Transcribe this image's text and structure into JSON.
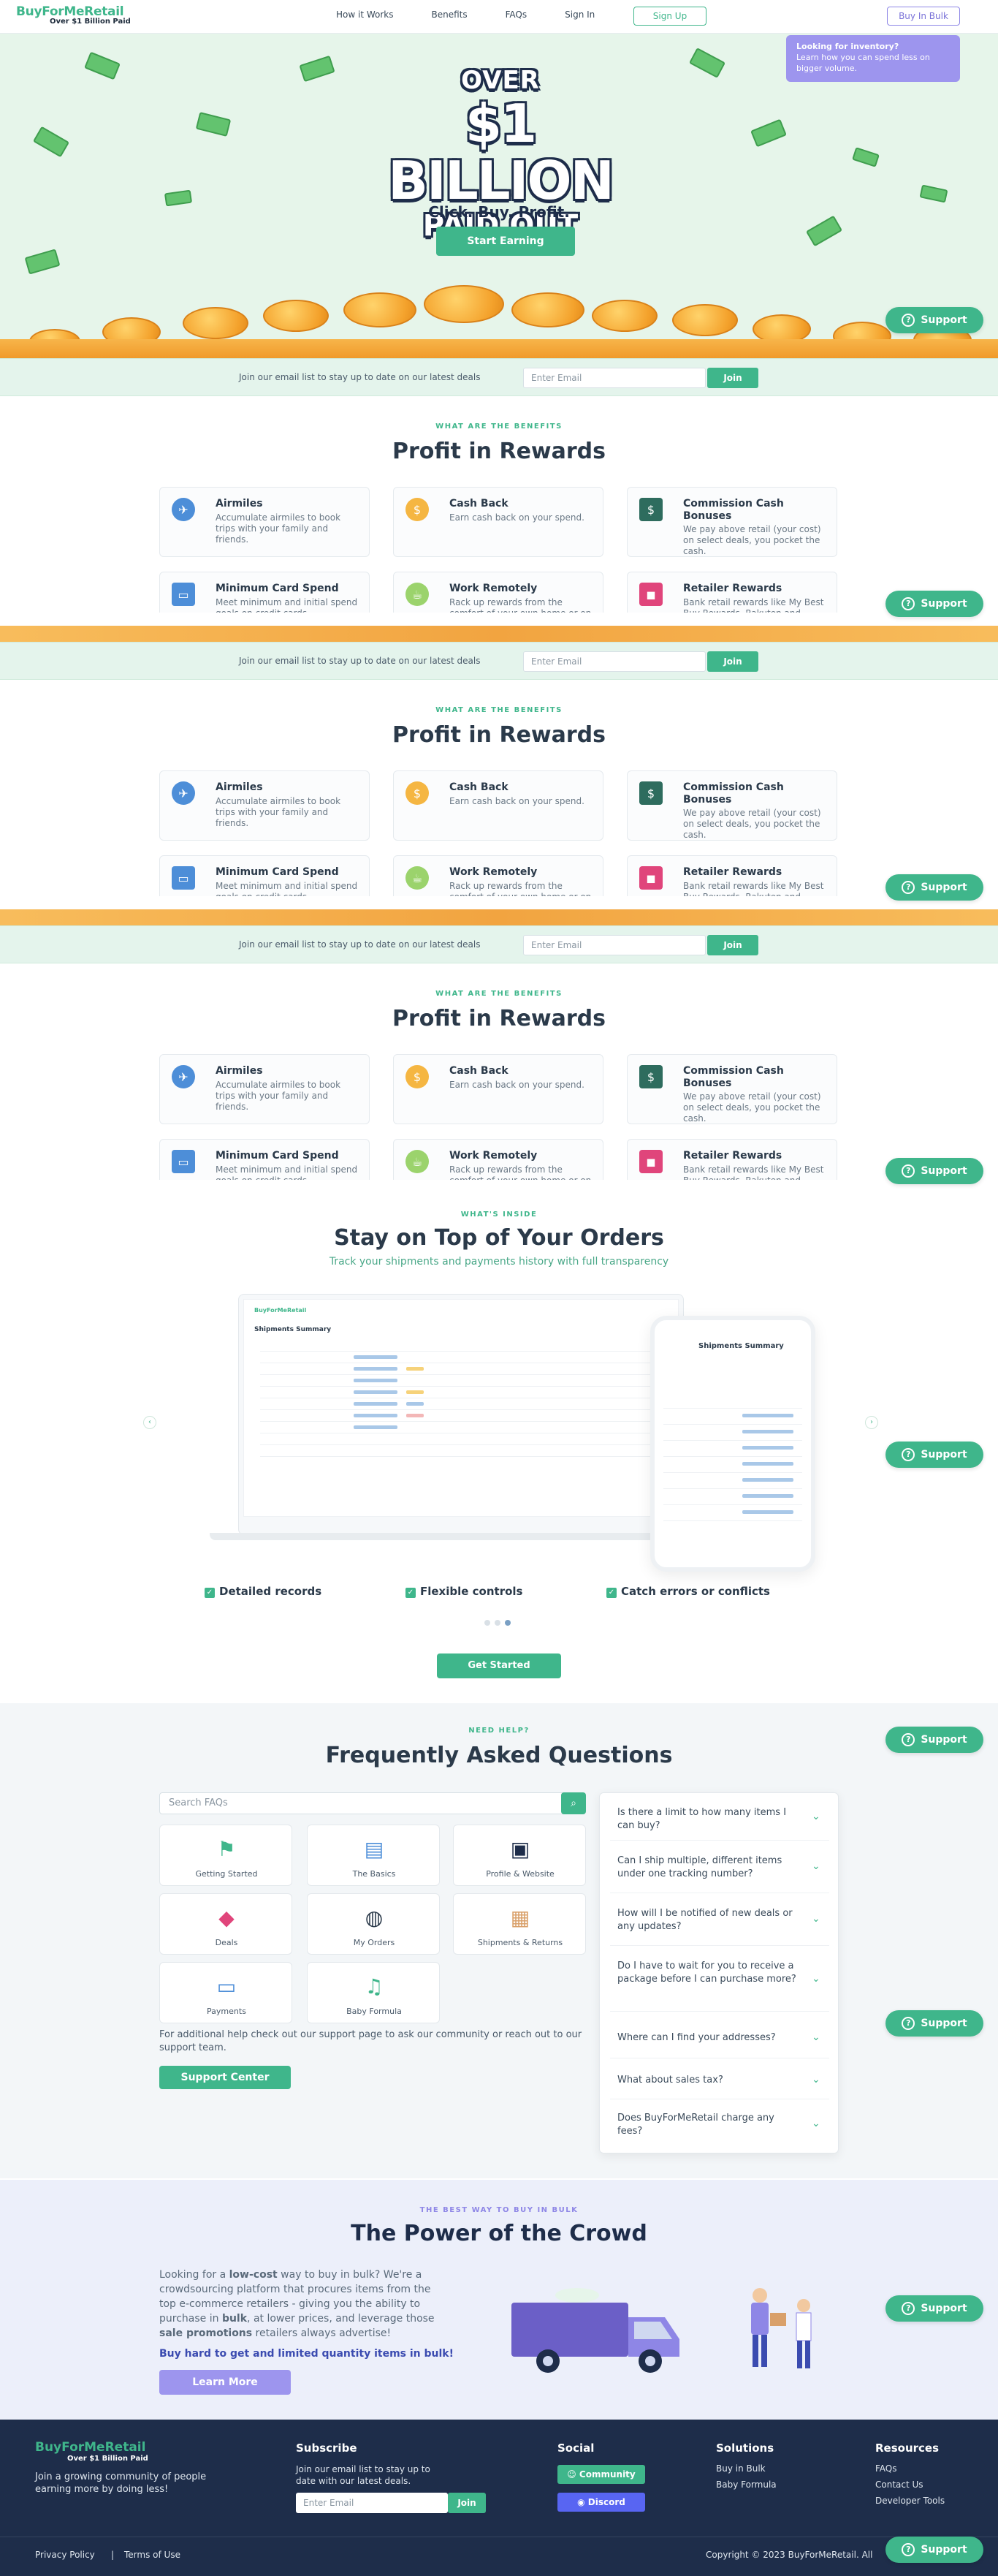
{
  "nav": {
    "logo": "BuyForMeRetail",
    "logo_sub": "Over $1 Billion Paid",
    "links": [
      "How it Works",
      "Benefits",
      "FAQs",
      "Sign In"
    ],
    "signup": "Sign Up",
    "bulk": "Buy In Bulk",
    "tooltip_title": "Looking for inventory?",
    "tooltip_text": "Learn how you can spend less on bigger volume."
  },
  "hero": {
    "over": "OVER",
    "billion": "$1 BILLION",
    "paid": "PAID OUT",
    "tagline": "Click. Buy. Profit.",
    "cta": "Start Earning"
  },
  "support_label": "Support",
  "email_strip": {
    "text": "Join our email list to stay up to date on our latest deals",
    "placeholder": "Enter Email",
    "button": "Join"
  },
  "benefits": {
    "kicker": "WHAT ARE THE BENEFITS",
    "title": "Profit in Rewards",
    "cards": [
      {
        "title": "Airmiles",
        "desc": "Accumulate airmiles to book trips with your family and friends.",
        "icon": "airplane-icon"
      },
      {
        "title": "Cash Back",
        "desc": "Earn cash back on your spend.",
        "icon": "coin-icon"
      },
      {
        "title": "Commission Cash Bonuses",
        "desc": "We pay above retail (your cost) on select deals, you pocket the cash.",
        "icon": "cash-icon"
      },
      {
        "title": "Minimum Card Spend",
        "desc": "Meet minimum and initial spend goals on credit cards.",
        "icon": "credit-card-icon"
      },
      {
        "title": "Work Remotely",
        "desc": "Rack up rewards from the comfort of your own home or on the go.",
        "icon": "coffee-icon"
      },
      {
        "title": "Retailer Rewards",
        "desc": "Bank retail rewards like My Best Buy Rewards, Rakuten and more.",
        "icon": "shopping-bag-icon"
      }
    ]
  },
  "orders": {
    "kicker": "WHAT'S INSIDE",
    "title": "Stay on Top of Your Orders",
    "subtitle": "Track your shipments and payments history with full transparency",
    "laptop_logo": "BuyForMeRetail",
    "laptop_heading": "Shipments Summary",
    "phone_heading": "Shipments Summary",
    "features": [
      "Detailed records",
      "Flexible controls",
      "Catch errors or conflicts"
    ],
    "cta": "Get Started"
  },
  "faq": {
    "kicker": "NEED HELP?",
    "title": "Frequently Asked Questions",
    "search_placeholder": "Search FAQs",
    "categories": [
      {
        "label": "Getting Started",
        "icon": "flags-icon"
      },
      {
        "label": "The Basics",
        "icon": "book-icon"
      },
      {
        "label": "Profile & Website",
        "icon": "profile-icon"
      },
      {
        "label": "Deals",
        "icon": "price-tag-icon"
      },
      {
        "label": "My Orders",
        "icon": "orders-bag-icon"
      },
      {
        "label": "Shipments & Returns",
        "icon": "box-icon"
      },
      {
        "label": "Payments",
        "icon": "cards-icon"
      },
      {
        "label": "Baby Formula",
        "icon": "bell-icon"
      }
    ],
    "help_text": "For additional help check out our support page to ask our community or reach out to our support team.",
    "support_center": "Support Center",
    "questions": [
      "Is there a limit to how many items I can buy?",
      "Can I ship multiple, different items under one tracking number?",
      "How will I be notified of new deals or any updates?",
      "Do I have to wait for you to receive a package before I can purchase more?",
      "Where can I find your addresses?",
      "What about sales tax?",
      "Does BuyForMeRetail charge any fees?"
    ]
  },
  "crowd": {
    "kicker": "THE BEST WAY TO BUY IN BULK",
    "title": "The Power of the Crowd",
    "text_1": "Looking for a ",
    "text_b1": "low-cost",
    "text_2": " way to buy in bulk? We're a crowdsourcing platform that procures items from the top e-commerce retailers - giving you the ability to purchase in ",
    "text_b2": "bulk",
    "text_3": ", at lower prices, and leverage those ",
    "text_b3": "sale promotions",
    "text_4": " retailers always advertise!",
    "highlight": "Buy hard to get and limited quantity items in bulk!",
    "cta": "Learn More"
  },
  "footer": {
    "brand": "BuyForMeRetail",
    "brand_sub": "Over $1 Billion Paid",
    "tagline": "Join a growing community of people earning more by doing less!",
    "subscribe_head": "Subscribe",
    "subscribe_text": "Join our email list to stay up to date with our latest deals.",
    "placeholder": "Enter Email",
    "join": "Join",
    "social_head": "Social",
    "community": "Community",
    "discord": "Discord",
    "solutions_head": "Solutions",
    "solutions": [
      "Buy in Bulk",
      "Baby Formula"
    ],
    "resources_head": "Resources",
    "resources": [
      "FAQs",
      "Contact Us",
      "Developer Tools"
    ],
    "privacy": "Privacy Policy",
    "terms": "Terms of Use",
    "copyright": "Copyright © 2023 BuyForMeRetail. All"
  },
  "colors": {
    "brand_green": "#3fb68b",
    "navy": "#1e2d4a",
    "purple": "#9d95ee",
    "coin_orange": "#f4a22c"
  }
}
